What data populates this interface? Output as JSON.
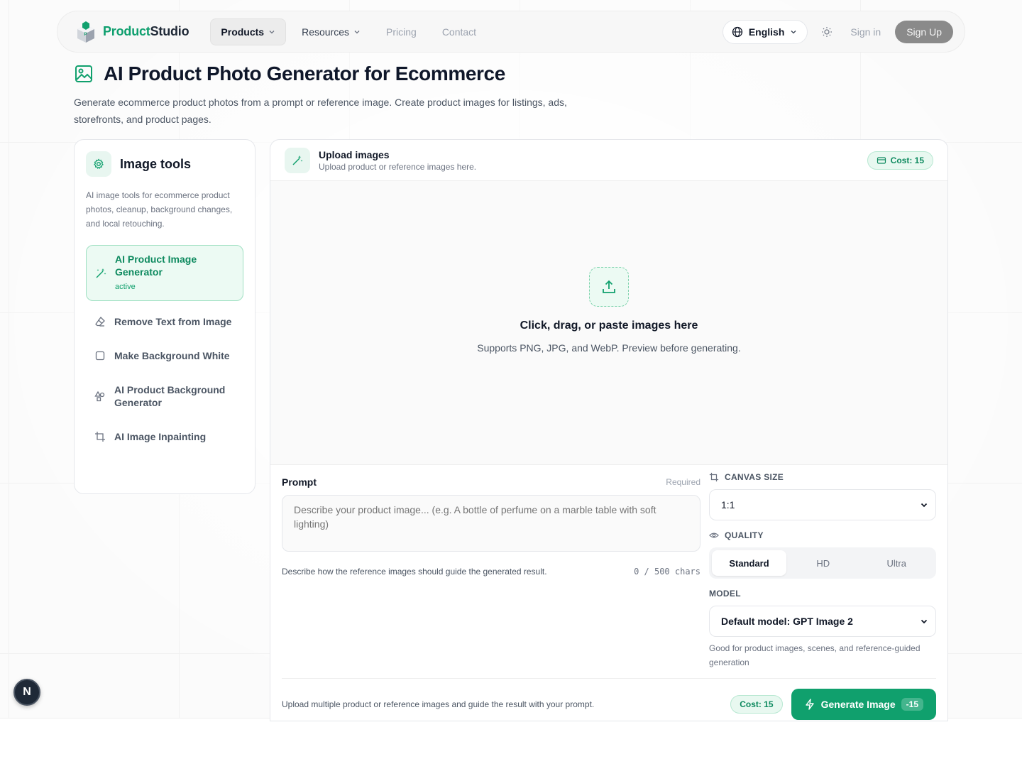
{
  "nav": {
    "brand_part1": "Product",
    "brand_part2": "Studio",
    "links": [
      {
        "label": "Products",
        "has_dropdown": true,
        "active": true
      },
      {
        "label": "Resources",
        "has_dropdown": true,
        "active": false
      },
      {
        "label": "Pricing",
        "has_dropdown": false,
        "active": false
      },
      {
        "label": "Contact",
        "has_dropdown": false,
        "active": false
      }
    ],
    "language": "English",
    "sign_in": "Sign in",
    "sign_up": "Sign Up"
  },
  "header": {
    "title": "AI Product Photo Generator for Ecommerce",
    "subtitle": "Generate ecommerce product photos from a prompt or reference image. Create product images for listings, ads, storefronts, and product pages."
  },
  "sidebar": {
    "title": "Image tools",
    "description": "AI image tools for ecommerce product photos, cleanup, background changes, and local retouching.",
    "tools": [
      {
        "label": "AI Product Image Generator",
        "status": "active",
        "icon": "magic-wand-icon"
      },
      {
        "label": "Remove Text from Image",
        "icon": "eraser-icon"
      },
      {
        "label": "Make Background White",
        "icon": "square-icon"
      },
      {
        "label": "AI Product Background Generator",
        "icon": "shapes-icon"
      },
      {
        "label": "AI Image Inpainting",
        "icon": "crop-icon"
      }
    ]
  },
  "upload": {
    "title": "Upload images",
    "subtitle": "Upload product or reference images here.",
    "cost": "Cost: 15",
    "drop_title": "Click, drag, or paste images here",
    "drop_sub": "Supports PNG, JPG, and WebP. Preview before generating."
  },
  "prompt": {
    "label": "Prompt",
    "required": "Required",
    "value": "",
    "placeholder": "Describe your product image... (e.g. A bottle of perfume on a marble table with soft lighting)",
    "help": "Describe how the reference images should guide the generated result.",
    "char_count": "0 / 500 chars"
  },
  "settings": {
    "canvas_label": "CANVAS SIZE",
    "canvas_value": "1:1",
    "quality_label": "QUALITY",
    "quality_options": [
      "Standard",
      "HD",
      "Ultra"
    ],
    "quality_selected": "Standard",
    "model_label": "MODEL",
    "model_value": "Default model: GPT Image 2",
    "model_help": "Good for product images, scenes, and reference-guided generation"
  },
  "footer": {
    "note": "Upload multiple product or reference images and guide the result with your prompt.",
    "cost": "Cost: 15",
    "generate_label": "Generate Image",
    "generate_cost": "-15"
  },
  "dev_badge": "N",
  "colors": {
    "accent": "#10a06d",
    "accent_light": "#ecfaf3",
    "text": "#111827",
    "muted": "#6b7280"
  }
}
